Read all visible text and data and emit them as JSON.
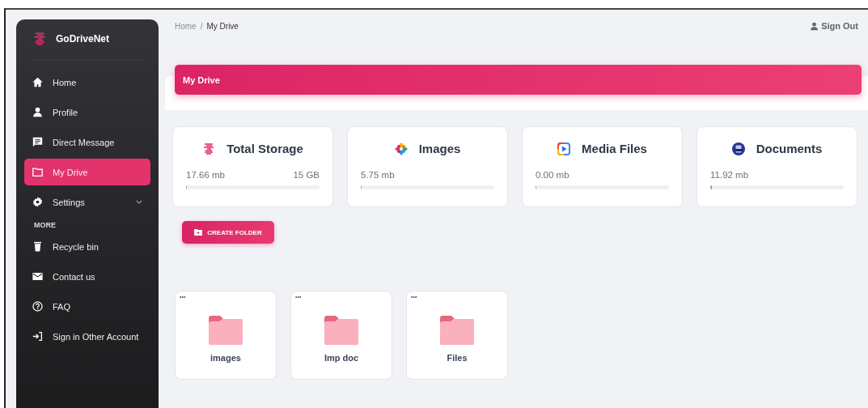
{
  "sidebar": {
    "brand": "GoDriveNet",
    "items": [
      {
        "kind": "item",
        "label": "Home",
        "selected": false
      },
      {
        "kind": "item",
        "label": "Profile",
        "selected": false
      },
      {
        "kind": "item",
        "label": "Direct Message",
        "selected": false
      },
      {
        "kind": "item",
        "label": "My Drive",
        "selected": true
      },
      {
        "kind": "item",
        "label": "Settings",
        "selected": false,
        "submenu": true
      },
      {
        "kind": "section",
        "label": "MORE"
      },
      {
        "kind": "item",
        "label": "Recycle bin",
        "selected": false
      },
      {
        "kind": "item",
        "label": "Contact us",
        "selected": false
      },
      {
        "kind": "item",
        "label": "FAQ",
        "selected": false
      },
      {
        "kind": "item",
        "label": "Sign in Other Account",
        "selected": false
      }
    ]
  },
  "breadcrumb": [
    "Home",
    "/",
    "My Drive"
  ],
  "sign_out": "Sign Out",
  "header": {
    "title": "My Drive"
  },
  "storage_cards": [
    {
      "kind": "total",
      "title": "Total Storage",
      "used": "17.66 mb",
      "capacity": "15 GB",
      "level": 0.001
    },
    {
      "kind": "images",
      "title": "Images",
      "used": "5.75 mb",
      "level": 0
    },
    {
      "kind": "media",
      "title": "Media Files",
      "used": "0.00 mb",
      "level": 0
    },
    {
      "kind": "documents",
      "title": "Documents",
      "used": "11.92 mb",
      "level": 0.01
    }
  ],
  "create_folder": "CREATE FOLDER",
  "folders": [
    {
      "menu": "•••",
      "name": "images"
    },
    {
      "menu": "•••",
      "name": "Imp doc"
    },
    {
      "menu": "•••",
      "name": "Files"
    }
  ]
}
